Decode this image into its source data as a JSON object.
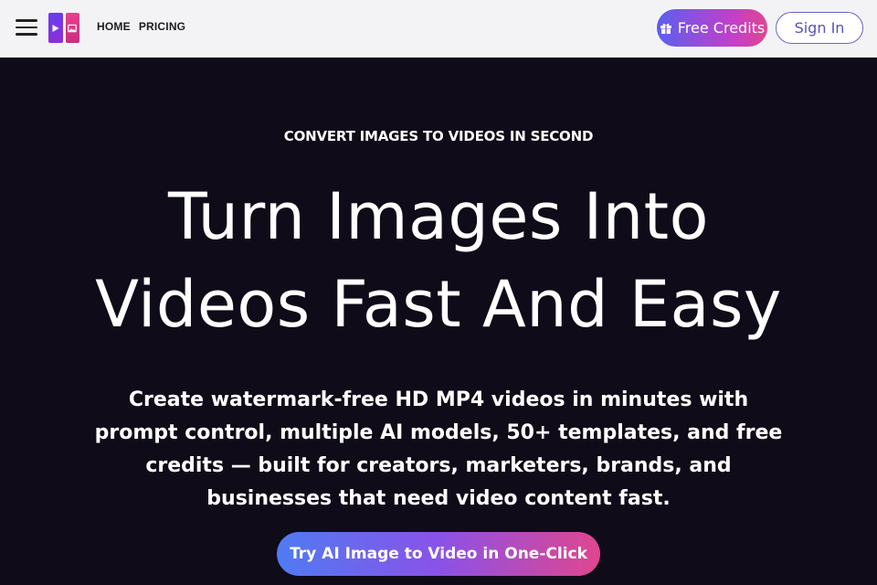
{
  "nav": {
    "items": [
      {
        "label": "HOME"
      },
      {
        "label": "PRICING"
      }
    ]
  },
  "header": {
    "free_credits_label": "Free Credits",
    "sign_in_label": "Sign In"
  },
  "hero": {
    "eyebrow": "CONVERT IMAGES TO VIDEOS IN SECOND",
    "headline_line1": "Turn Images Into",
    "headline_line2": "Videos Fast And Easy",
    "subtext": "Create watermark-free HD MP4 videos in minutes with prompt control, multiple AI models, 50+ templates, and free credits — built for creators, marketers, brands, and businesses that need video content fast.",
    "cta_label": "Try AI Image to Video in One-Click"
  },
  "colors": {
    "hero_bg": "#0f0b18",
    "header_bg": "#f3f3f5",
    "accent_purple": "#6a63c9",
    "accent_pink": "#e0468e"
  },
  "icons": {
    "menu": "hamburger-icon",
    "logo": "app-logo",
    "gift": "gift-icon"
  }
}
